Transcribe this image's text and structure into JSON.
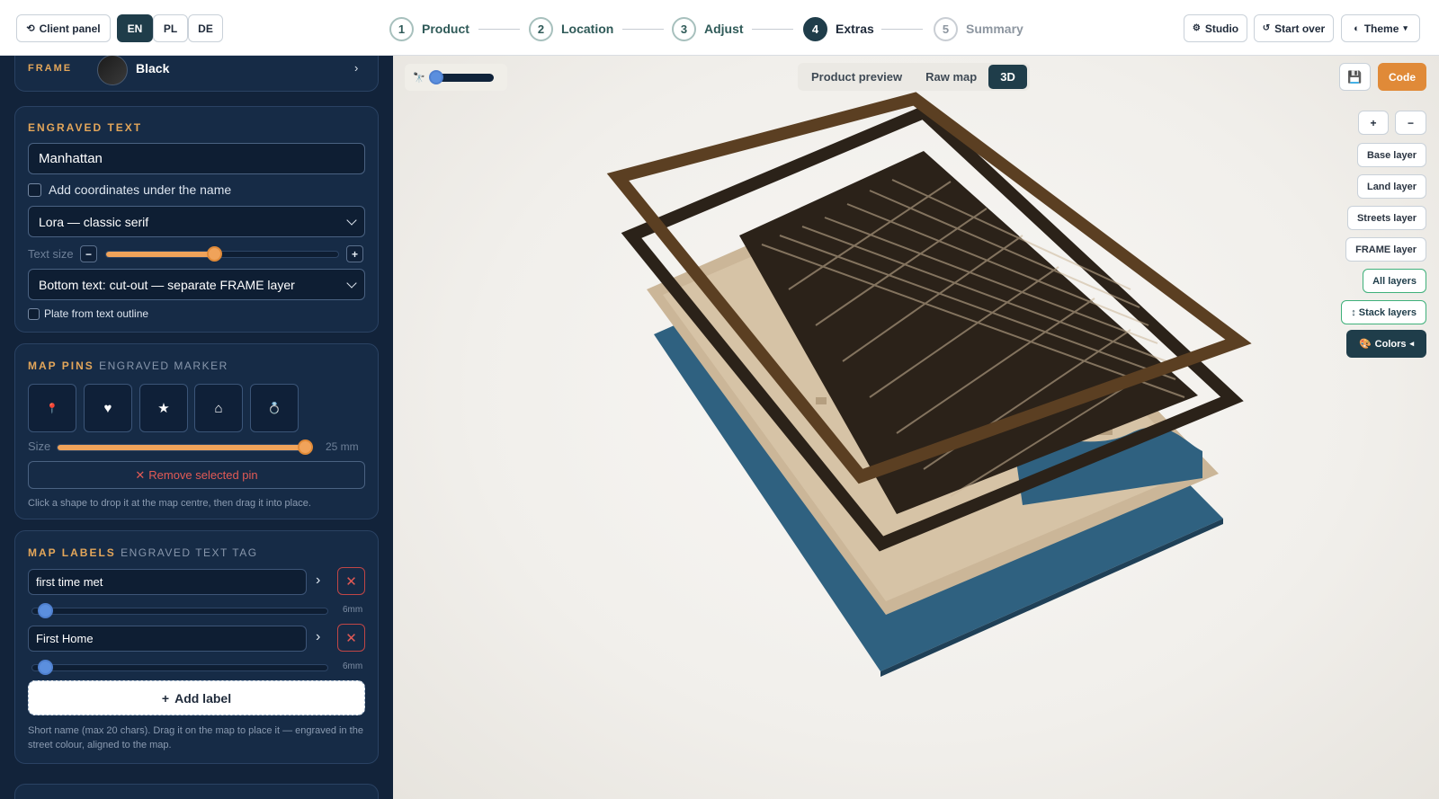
{
  "topbar": {
    "client_panel": "Client panel",
    "languages": [
      "EN",
      "PL",
      "DE"
    ],
    "steps": [
      {
        "num": "1",
        "label": "Product"
      },
      {
        "num": "2",
        "label": "Location"
      },
      {
        "num": "3",
        "label": "Adjust"
      },
      {
        "num": "4",
        "label": "Extras"
      },
      {
        "num": "5",
        "label": "Summary"
      }
    ],
    "studio": "Studio",
    "start_over": "Start over",
    "theme": "Theme"
  },
  "frame": {
    "label": "FRAME",
    "value": "Black"
  },
  "engraved": {
    "title": "ENGRAVED TEXT",
    "text_value": "Manhattan",
    "coords_label": "Add coordinates under the name",
    "font_select": "Lora — classic serif",
    "text_size_label": "Text size",
    "text_size_level": 0.46,
    "bottom_select": "Bottom text: cut-out — separate FRAME layer",
    "plate_label": "Plate from text outline"
  },
  "pins": {
    "title": "MAP PINS",
    "subtitle": "ENGRAVED MARKER",
    "shapes": [
      "📍",
      "♥",
      "★",
      "⌂",
      "💍"
    ],
    "size_label": "Size",
    "size_value": "25 mm",
    "size_level": 1.0,
    "remove_label": "Remove selected pin",
    "hint": "Click a shape to drop it at the map centre, then drag it into place."
  },
  "labels": {
    "title": "MAP LABELS",
    "subtitle": "ENGRAVED TEXT TAG",
    "items": [
      {
        "text": "first time met",
        "size": "6mm"
      },
      {
        "text": "First Home",
        "size": "6mm"
      }
    ],
    "add_label": "Add label",
    "hint": "Short name (max 20 chars). Drag it on the map to place it — engraved in the street colour, aligned to the map."
  },
  "viewport": {
    "view_tabs": [
      "Product preview",
      "Raw map",
      "3D"
    ],
    "active_tab": "3D",
    "code_label": "Code",
    "zoom_in": "+",
    "zoom_out": "−",
    "layers": [
      "Base layer",
      "Land layer",
      "Streets layer",
      "FRAME layer",
      "All layers",
      "Stack layers"
    ],
    "colors_label": "Colors"
  },
  "colors": {
    "sidebar_bg": "#12233a",
    "accent_orange": "#e08a38",
    "primary_dark": "#1f3d4a",
    "water": "#2f6180",
    "land": "#cbb698",
    "frame_wood": "#5b3f22",
    "streets": "#2b2219"
  }
}
